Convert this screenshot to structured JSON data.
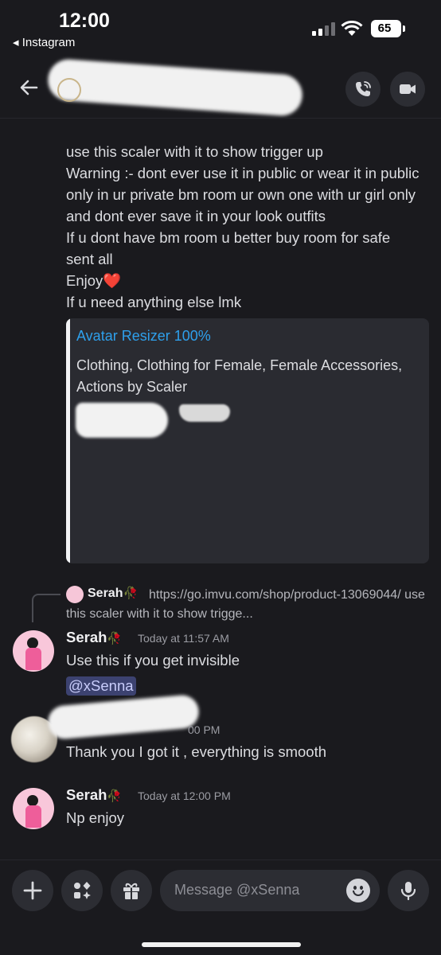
{
  "status_bar": {
    "time": "12:00",
    "back_app": "◂ Instagram",
    "battery": "65"
  },
  "header": {
    "back_icon": "arrow-left-icon",
    "call_icon": "phone-call-icon",
    "video_icon": "video-camera-icon"
  },
  "messages": {
    "instructions": "use this scaler with it to show trigger up\nWarning :- dont ever use it in public or wear it in public only in ur private bm room ur own one with ur girl only and dont ever save it in your look outfits\nIf u dont have bm room u better buy room for safe\nsent all\nEnjoy",
    "instructions_tail": "If u need anything else lmk",
    "embed": {
      "title": "Avatar Resizer 100%",
      "description": "Clothing, Clothing for Female, Female Accessories, Actions by Scaler"
    },
    "reply": {
      "author": "Serah",
      "text": "https://go.imvu.com/shop/product-13069044/  use this scaler with it to show trigge..."
    },
    "msg1": {
      "author": "Serah",
      "timestamp": "Today at 11:57 AM",
      "text": "Use this if you get invisible",
      "mention": "@xSenna"
    },
    "msg2": {
      "timestamp_partial": "00 PM",
      "text": "Thank you I got it , everything is smooth"
    },
    "msg3": {
      "author": "Serah",
      "timestamp": "Today at 12:00 PM",
      "text": "Np enjoy"
    }
  },
  "composer": {
    "placeholder": "Message @xSenna",
    "icons": [
      "plus-icon",
      "apps-icon",
      "gift-icon",
      "emoji-icon",
      "microphone-icon"
    ]
  },
  "colors": {
    "background": "#1a1a1e",
    "link": "#2ea0ec",
    "mention_bg": "#3c4270",
    "heart": "#e0202a"
  }
}
